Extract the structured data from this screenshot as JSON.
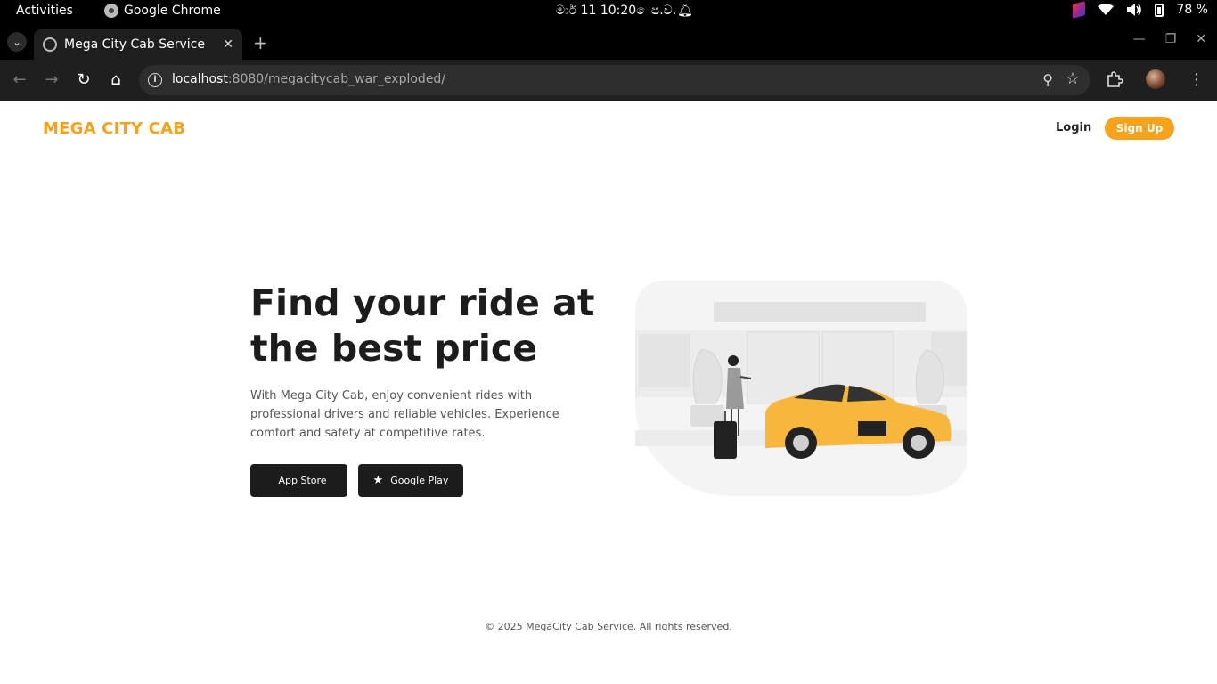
{
  "system_bar": {
    "activities": "Activities",
    "app_name": "Google Chrome",
    "clock": "මාර් 11  10:20 ෙප.ව.",
    "battery": "78 %"
  },
  "browser": {
    "tab_title": "Mega City Cab Service",
    "url_host": "localhost",
    "url_path": ":8080/megacitycab_war_exploded/"
  },
  "page": {
    "logo": "MEGA CITY CAB",
    "nav": {
      "login": "Login",
      "signup": "Sign Up"
    },
    "hero": {
      "title": "Find your ride at the best price",
      "description": "With Mega City Cab, enjoy convenient rides with professional drivers and reliable vehicles. Experience comfort and safety at competitive rates.",
      "app_store": "App Store",
      "google_play": "Google Play"
    },
    "footer": "© 2025 MegaCity Cab Service. All rights reserved."
  },
  "colors": {
    "accent": "#f6a21a",
    "dark_button": "#1c1c1c"
  }
}
